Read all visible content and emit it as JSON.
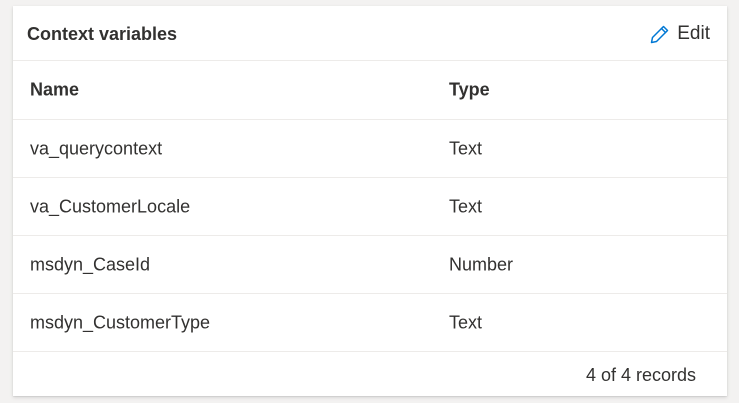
{
  "card": {
    "title": "Context variables",
    "edit_label": "Edit"
  },
  "table": {
    "columns": [
      "Name",
      "Type"
    ],
    "rows": [
      {
        "name": "va_querycontext",
        "type": "Text"
      },
      {
        "name": "va_CustomerLocale",
        "type": "Text"
      },
      {
        "name": "msdyn_CaseId",
        "type": "Number"
      },
      {
        "name": "msdyn_CustomerType",
        "type": "Text"
      }
    ]
  },
  "footer": {
    "record_count": "4 of 4 records"
  },
  "icons": {
    "edit": "pencil-icon"
  }
}
